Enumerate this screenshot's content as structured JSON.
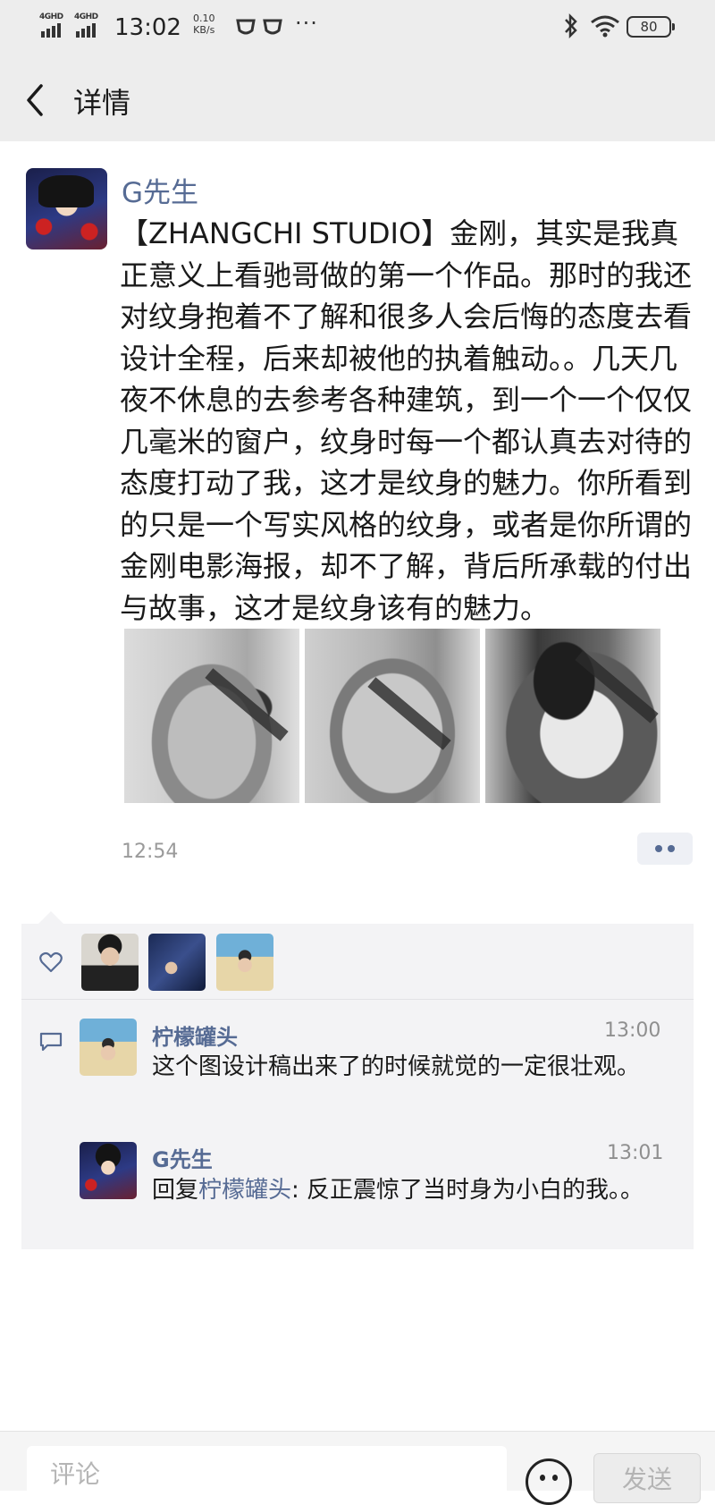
{
  "status_bar": {
    "signal1_label": "4GHD",
    "signal2_label": "4GHD",
    "time": "13:02",
    "speed_value": "0.10",
    "speed_unit": "KB/s",
    "more": "···",
    "battery": "80"
  },
  "nav": {
    "title": "详情"
  },
  "post": {
    "author": "G先生",
    "text": "【ZHANGCHI STUDIO】金刚，其实是我真正意义上看驰哥做的第一个作品。那时的我还对纹身抱着不了解和很多人会后悔的态度去看设计全程，后来却被他的执着触动。。几天几夜不休息的去参考各种建筑，到一个一个仅仅几毫米的窗户，纹身时每一个都认真去对待的态度打动了我，这才是纹身的魅力。你所看到的只是一个写实风格的纹身，或者是你所谓的金刚电影海报，却不了解，背后所承载的付出与故事，这才是纹身该有的魅力。",
    "time": "12:54"
  },
  "comments": [
    {
      "name": "柠檬罐头",
      "time": "13:00",
      "text": "这个图设计稿出来了的时候就觉的一定很壮观。"
    },
    {
      "name": "G先生",
      "time": "13:01",
      "reply_prefix": "回复",
      "reply_to": "柠檬罐头",
      "text": ": 反正震惊了当时身为小白的我。。"
    }
  ],
  "input": {
    "placeholder": "评论",
    "send_label": "发送"
  },
  "colors": {
    "link": "#566b94",
    "header_bg": "#ededed",
    "panel_bg": "#f3f3f5"
  }
}
